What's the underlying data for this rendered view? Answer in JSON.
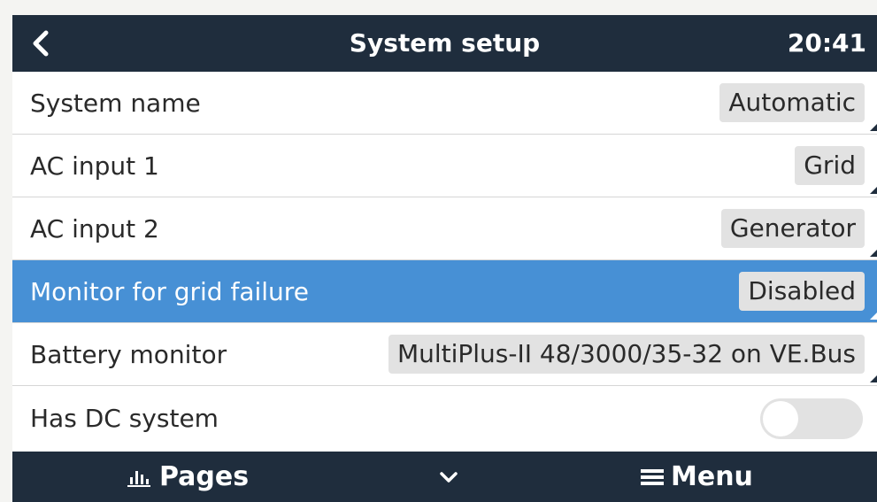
{
  "header": {
    "title": "System setup",
    "time": "20:41",
    "back_icon": "chevron-left-icon"
  },
  "settings": [
    {
      "label": "System name",
      "value": "Automatic",
      "type": "select",
      "selected": false
    },
    {
      "label": "AC input 1",
      "value": "Grid",
      "type": "select",
      "selected": false
    },
    {
      "label": "AC input 2",
      "value": "Generator",
      "type": "select",
      "selected": false
    },
    {
      "label": "Monitor for grid failure",
      "value": "Disabled",
      "type": "select",
      "selected": true
    },
    {
      "label": "Battery monitor",
      "value": "MultiPlus-II 48/3000/35-32 on VE.Bus",
      "type": "select",
      "selected": false
    },
    {
      "label": "Has DC system",
      "type": "toggle",
      "toggle_on": false,
      "selected": false
    }
  ],
  "footer": {
    "pages_label": "Pages",
    "pages_icon": "bar-chart-icon",
    "chevron_icon": "chevron-down-icon",
    "menu_label": "Menu",
    "menu_icon": "hamburger-icon"
  },
  "colors": {
    "bar_bg": "#1f2d3d",
    "selected_bg": "#4790d5",
    "value_bg": "#e2e2e2"
  }
}
